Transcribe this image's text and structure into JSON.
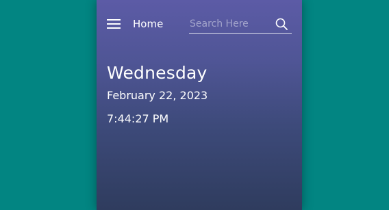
{
  "nav": {
    "home_label": "Home"
  },
  "search": {
    "placeholder": "Search Here",
    "value": ""
  },
  "icons": {
    "menu": "hamburger-menu-icon",
    "search": "search-icon"
  },
  "datetime": {
    "day": "Wednesday",
    "date": "February 22, 2023",
    "time": "7:44:27 PM"
  },
  "colors": {
    "background": "#028582",
    "panel_top": "#5c5ba6",
    "panel_bottom": "#2f3c5e",
    "text": "#ffffff"
  }
}
